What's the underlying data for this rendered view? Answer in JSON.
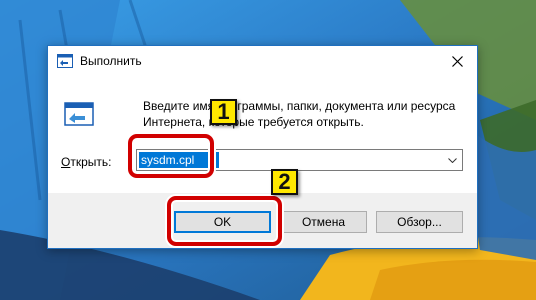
{
  "dialog": {
    "title": "Выполнить",
    "description_line1": "Введите имя программы, папки, документа или ресурса",
    "description_line2": "Интернета, которые требуется открыть.",
    "open_label_access": "О",
    "open_label_rest": "ткрыть:",
    "input_value": "sysdm.cpl",
    "buttons": {
      "ok": "OK",
      "cancel": "Отмена",
      "browse": "Обзор..."
    }
  },
  "annotations": {
    "step1": "1",
    "step2": "2",
    "highlight_color": "#d10000",
    "badge_color": "#ffe800"
  },
  "colors": {
    "selection": "#0078d7",
    "footer": "#f0f0f0",
    "button": "#e1e1e1"
  }
}
